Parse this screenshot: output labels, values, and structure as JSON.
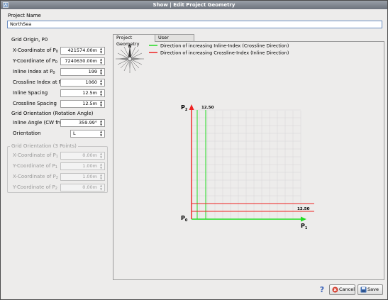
{
  "window": {
    "title": "Show | Edit Project Geometry"
  },
  "project": {
    "name_label": "Project Name",
    "name_value": "NorthSea"
  },
  "grid_origin": {
    "title": "Grid Origin, P0",
    "fields": [
      {
        "label": "X-Coordinate of P",
        "sub": "0",
        "value": "421574.00m"
      },
      {
        "label": "Y-Coordinate of P",
        "sub": "0",
        "value": "7240630.00m"
      },
      {
        "label": "Inline Index at P",
        "sub": "0",
        "value": "199"
      },
      {
        "label": "Crossline Index at P",
        "sub": "0",
        "value": "1060"
      },
      {
        "label": "Inline Spacing",
        "sub": "",
        "value": "12.5m"
      },
      {
        "label": "Crossline Spacing",
        "sub": "",
        "value": "12.5m"
      }
    ]
  },
  "orientation": {
    "title": "Grid Orientation (Rotation Angle)",
    "inline_angle_label": "Inline Angle (CW from North)",
    "inline_angle_value": "359.99°",
    "orientation_label": "Orientation",
    "orientation_value": "L"
  },
  "three_points": {
    "title": "Grid Orientation (3 Points)",
    "fields": [
      {
        "label": "X-Coordinate of P",
        "sub": "1",
        "value": "0.00m"
      },
      {
        "label": "Y-Coordinate of P",
        "sub": "1",
        "value": "1.00m"
      },
      {
        "label": "X-Coordinate of P",
        "sub": "2",
        "value": "1.00m"
      },
      {
        "label": "Y-Coordinate of P",
        "sub": "2",
        "value": "0.00m"
      }
    ]
  },
  "tabs": [
    {
      "label": "Project Geometry",
      "active": true
    },
    {
      "label": "User Comments",
      "active": false
    }
  ],
  "diagram": {
    "compass_label": "N",
    "legend": [
      {
        "color": "#22dd22",
        "text": "Direction of increasing Inline-Index (Crossline Direction)"
      },
      {
        "color": "#ee2222",
        "text": "Direction of increasing Crossline-Index (Inline Direction)"
      }
    ],
    "axis_p0": "P",
    "axis_p0_sub": "0",
    "axis_p1": "P",
    "axis_p1_sub": "1",
    "axis_p2": "P",
    "axis_p2_sub": "2",
    "spacing_top": "12.50",
    "spacing_right": "12.50",
    "grid_color": "#d6d6d6",
    "green": "#22dd22",
    "red": "#ee2222"
  },
  "buttons": {
    "help_icon": "help-icon",
    "cancel": "Cancel",
    "save": "Save"
  }
}
